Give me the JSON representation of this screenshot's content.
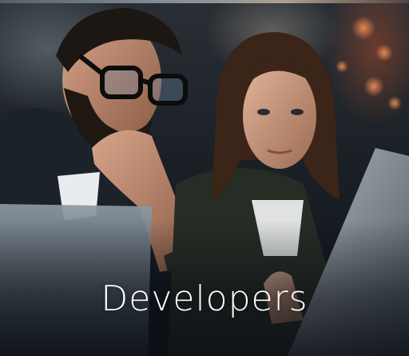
{
  "card": {
    "title": "Developers",
    "image_description_icon": "photo-two-people-at-laptop"
  },
  "colors": {
    "title_text": "#ffffff",
    "overlay": "#0a0e14"
  }
}
